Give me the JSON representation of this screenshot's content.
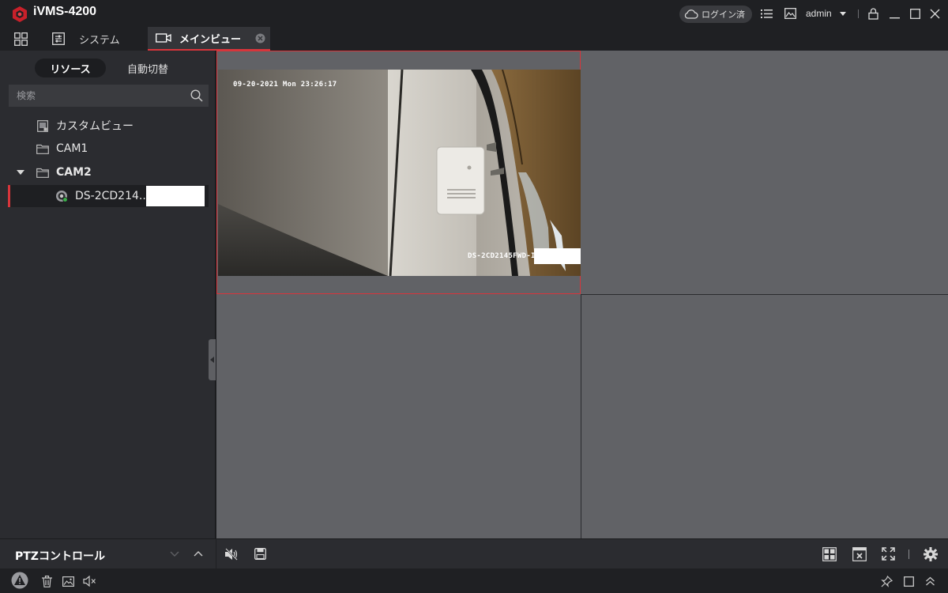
{
  "app": {
    "title": "iVMS-4200",
    "login_status": "ログイン済",
    "user": "admin"
  },
  "tabs": [
    {
      "label": ""
    },
    {
      "label": "システム"
    },
    {
      "label": "メインビュー",
      "active": true
    }
  ],
  "left_panel": {
    "segments": [
      "リソース",
      "自動切替"
    ],
    "search_placeholder": "検索",
    "tree": [
      {
        "label": "カスタムビュー",
        "icon": "custom-view-icon"
      },
      {
        "label": "CAM1",
        "icon": "folder-icon"
      },
      {
        "label": "CAM2",
        "icon": "folder-icon",
        "expanded": true
      },
      {
        "label": "DS-2CD214..",
        "icon": "camera-icon",
        "selected": true
      }
    ],
    "ptz_label": "PTZコントロール"
  },
  "video": {
    "timestamp": "09-20-2021 Mon 23:26:17",
    "camera_osd": "DS-2CD2145FWD-I"
  },
  "colors": {
    "accent": "#d8353b",
    "background": "#1f2023",
    "panel": "#2b2c30",
    "grid": "#616266"
  }
}
